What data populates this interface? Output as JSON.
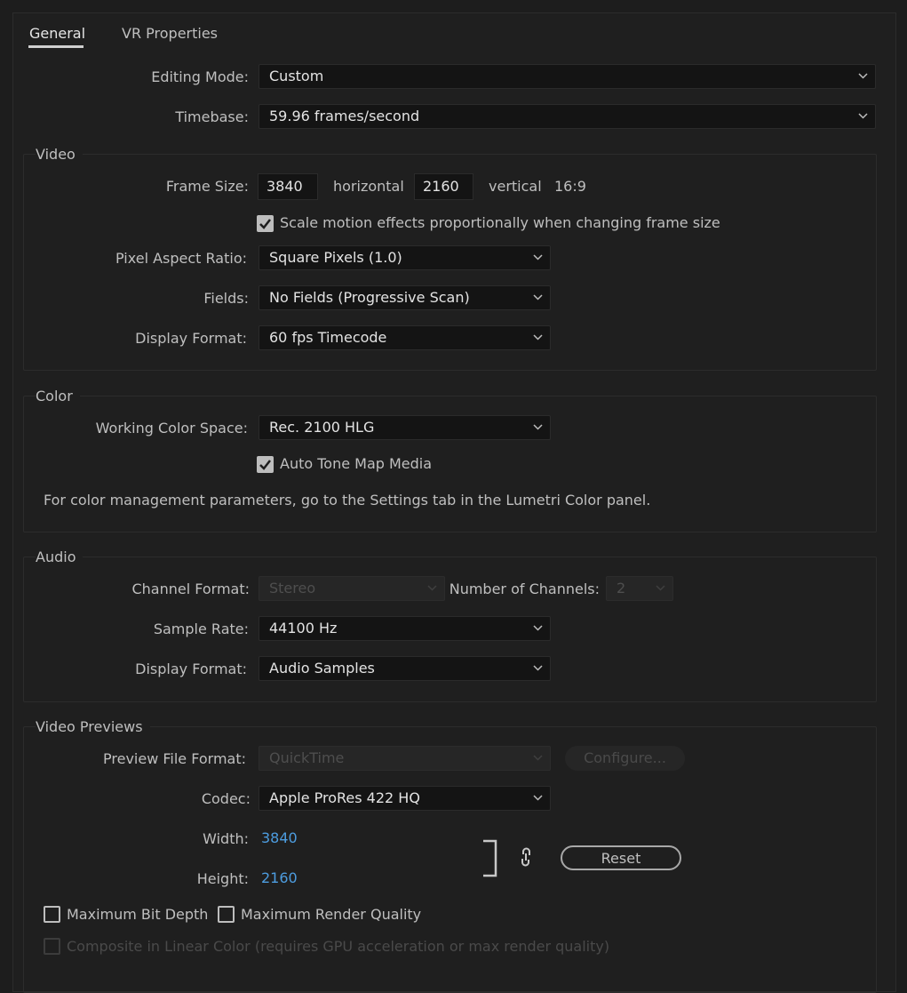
{
  "tabs": [
    {
      "label": "General"
    },
    {
      "label": "VR Properties"
    }
  ],
  "editing_mode": {
    "label": "Editing Mode:",
    "value": "Custom"
  },
  "timebase": {
    "label": "Timebase:",
    "value": "59.96  frames/second"
  },
  "video": {
    "title": "Video",
    "frame_size_label": "Frame Size:",
    "width": "3840",
    "horizontal_label": "horizontal",
    "height": "2160",
    "vertical_label": "vertical",
    "aspect": "16:9",
    "scale_motion_label": "Scale motion effects proportionally when changing frame size",
    "scale_motion_checked": true,
    "pixel_aspect_label": "Pixel Aspect Ratio:",
    "pixel_aspect_value": "Square Pixels (1.0)",
    "fields_label": "Fields:",
    "fields_value": "No Fields (Progressive Scan)",
    "display_format_label": "Display Format:",
    "display_format_value": "60 fps Timecode"
  },
  "color": {
    "title": "Color",
    "working_space_label": "Working Color Space:",
    "working_space_value": "Rec. 2100 HLG",
    "auto_tone_label": "Auto Tone Map Media",
    "auto_tone_checked": true,
    "note": "For color management parameters, go to the Settings tab in the Lumetri Color panel."
  },
  "audio": {
    "title": "Audio",
    "channel_format_label": "Channel Format:",
    "channel_format_value": "Stereo",
    "num_channels_label": "Number of Channels:",
    "num_channels_value": "2",
    "sample_rate_label": "Sample Rate:",
    "sample_rate_value": "44100 Hz",
    "display_format_label": "Display Format:",
    "display_format_value": "Audio Samples"
  },
  "previews": {
    "title": "Video Previews",
    "file_format_label": "Preview File Format:",
    "file_format_value": "QuickTime",
    "configure_label": "Configure...",
    "codec_label": "Codec:",
    "codec_value": "Apple ProRes 422 HQ",
    "width_label": "Width:",
    "width_value": "3840",
    "height_label": "Height:",
    "height_value": "2160",
    "reset_label": "Reset",
    "max_bit_depth_label": "Maximum Bit Depth",
    "max_render_quality_label": "Maximum Render Quality",
    "composite_linear_label": "Composite in Linear Color (requires GPU acceleration or max render quality)"
  },
  "colors": {
    "background": "#1d1d1d",
    "field": "#141414",
    "link": "#4d9de0"
  }
}
